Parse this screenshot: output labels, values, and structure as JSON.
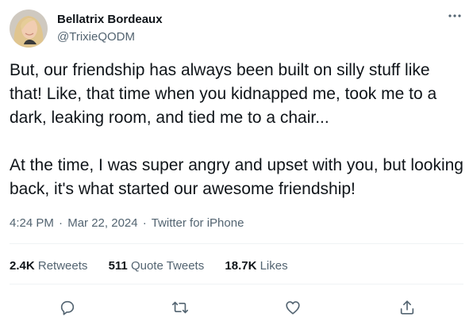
{
  "author": {
    "display_name": "Bellatrix Bordeaux",
    "handle": "@TrixieQODM",
    "avatar_icon": "profile-photo"
  },
  "tweet": {
    "paragraphs": [
      "But, our friendship has always been built on silly stuff like that! Like, that time when you kidnapped me, took me to a dark, leaking room, and tied me to a chair...",
      "At the time, I was super angry and upset with you, but looking back, it's what started our awesome friendship!"
    ],
    "time": "4:24 PM",
    "date": "Mar 22, 2024",
    "source": "Twitter for iPhone",
    "separator": "·"
  },
  "stats": {
    "retweets_count": "2.4K",
    "retweets_label": "Retweets",
    "quotes_count": "511",
    "quotes_label": "Quote Tweets",
    "likes_count": "18.7K",
    "likes_label": "Likes"
  },
  "icons": {
    "more": "more-icon",
    "reply": "reply-icon",
    "retweet": "retweet-icon",
    "like": "heart-icon",
    "share": "share-icon"
  },
  "colors": {
    "primary_text": "#0f1419",
    "secondary_text": "#536471",
    "divider": "#eff3f4"
  }
}
